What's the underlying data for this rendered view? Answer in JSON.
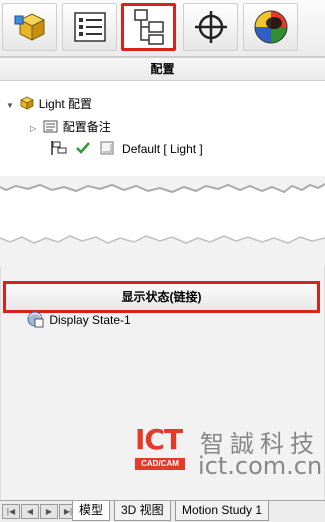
{
  "toolbar": {
    "tabs": [
      {
        "name": "feature-manager-tab",
        "icon": "part-cube-icon"
      },
      {
        "name": "property-manager-tab",
        "icon": "property-list-icon"
      },
      {
        "name": "configuration-manager-tab",
        "icon": "configuration-tree-icon",
        "active": true
      },
      {
        "name": "dimxpert-manager-tab",
        "icon": "crosshair-icon"
      },
      {
        "name": "display-manager-tab",
        "icon": "appearance-sphere-icon"
      }
    ]
  },
  "config_panel": {
    "title": "配置",
    "tree": {
      "root_label": "Light 配置",
      "notes_label": "配置备注",
      "default_label": "Default [ Light ]"
    }
  },
  "display_panel": {
    "title": "显示状态(链接)",
    "items": [
      "Display State-1"
    ]
  },
  "watermark": {
    "logo_text": "ICT",
    "logo_sub": "CAD/CAM",
    "company_cn": "智誠科技",
    "url": "ict.com.cn"
  },
  "bottom_tabs": [
    "模型",
    "3D 视图",
    "Motion Study 1"
  ],
  "colors": {
    "highlight": "#d6231e",
    "check": "#2e9a2e"
  }
}
